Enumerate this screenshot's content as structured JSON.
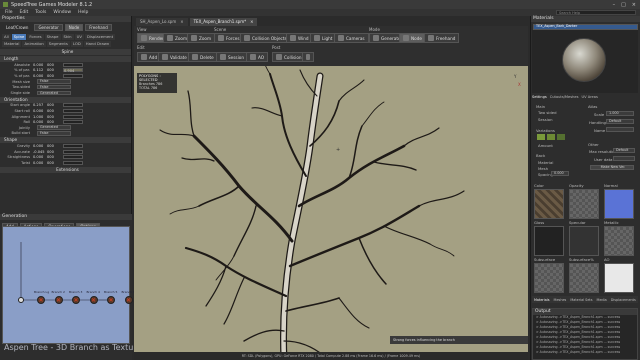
{
  "window": {
    "title": "SpeedTree Games Modeler 8.1.2",
    "controls": [
      "–",
      "□",
      "×"
    ]
  },
  "menu": {
    "items": [
      "File",
      "Edit",
      "Tools",
      "Window",
      "Help"
    ],
    "search_placeholder": "Search Help"
  },
  "left": {
    "properties_header": "Properties",
    "mode_label": "Leaf/Crown",
    "mode_buttons": [
      "Generator",
      "Node",
      "Freehand"
    ],
    "tabs": [
      "All",
      "Spine",
      "Forces",
      "Shape",
      "Skin",
      "UV",
      "Displacement",
      "Material",
      "Animation",
      "Segments",
      "LOD",
      "Hand Drawn"
    ],
    "section_spine": "Spine",
    "section_length": "Length",
    "length_rows": [
      {
        "label": "Absolute",
        "value": "0.000",
        "extra": "000"
      },
      {
        "label": "% of par.",
        "value": "0.112",
        "extra": "000",
        "drop": "0.904"
      },
      {
        "label": "% of par.",
        "value": "0.000",
        "extra": "000"
      },
      {
        "label": "Mesh size",
        "value": "",
        "extra": "",
        "drop": "False"
      },
      {
        "label": "Two-sided",
        "value": "",
        "extra": "",
        "drop": "False"
      },
      {
        "label": "Single side",
        "value": "",
        "extra": "",
        "drop": "Generated"
      }
    ],
    "section_orientation": "Orientation",
    "orientation_rows": [
      {
        "label": "Start angle",
        "value": "0.257",
        "extra": "000"
      },
      {
        "label": "Start roll",
        "value": "0.000",
        "extra": "000"
      },
      {
        "label": "Alignment",
        "value": "1.000",
        "extra": "000"
      },
      {
        "label": "Roll",
        "value": "0.000",
        "extra": "000"
      },
      {
        "label": "Jointly",
        "value": "",
        "extra": "",
        "drop": "Generated"
      },
      {
        "label": "Build start",
        "value": "",
        "extra": "",
        "drop": "False"
      }
    ],
    "section_shape": "Shape",
    "shape_rows": [
      {
        "label": "Gravity",
        "value": "0.000",
        "extra": "000"
      },
      {
        "label": "Accurate",
        "value": "-0.045",
        "extra": "000"
      },
      {
        "label": "Straightness",
        "value": "0.000",
        "extra": "000"
      },
      {
        "label": "Twist",
        "value": "0.000",
        "extra": "000"
      }
    ],
    "extensions_label": "Extensions",
    "generation_header": "Generation",
    "gen_buttons": [
      "Add",
      "Actions",
      "Operations",
      "Options"
    ],
    "nodes": [
      "Branch Lg",
      "Branch 2",
      "Branch 3",
      "Branch 4",
      "Branch 5",
      "Branch 6"
    ],
    "watermark": "Aspen Tree - 3D Branch as Texture"
  },
  "center": {
    "doc_tabs": [
      {
        "label": "SH_Aspen_Lo.spm",
        "active": false
      },
      {
        "label": "TEX_Aspen_Branch1.spm*",
        "active": true
      }
    ],
    "groups": {
      "view": "View",
      "scene": "Scene",
      "mode": "Mode",
      "edit": "Edit",
      "post": "Post"
    },
    "view_buttons": [
      "Render",
      "Zoom",
      "Zoom"
    ],
    "scene_buttons": [
      "Forces",
      "Collision Objects",
      "Wind",
      "Light",
      "Cameras"
    ],
    "mode_buttons": [
      "Generator",
      "Node",
      "Freehand"
    ],
    "edit_buttons": [
      "Add",
      "Validate",
      "Delete",
      "Session",
      "AO",
      "Collision",
      ""
    ],
    "info": {
      "header": "POLYGONS : SELECTED",
      "rows": [
        {
          "label": "Branches",
          "value": "786"
        },
        {
          "label": "TOTAL",
          "value": "786"
        }
      ]
    },
    "status_msg": "Strong forces influencing the branch",
    "status_bar": "RT: SDL (Polygons), GPU: GeForce RTX 2080 / Total Compute 2.88 ms (Frame 16.6 ms) / (Frame 1009.49 ms)"
  },
  "right": {
    "materials_header": "Materials",
    "material_name": "TEX_Aspen_Bark_Darker",
    "tabs": [
      "Settings",
      "Cutouts/Meshes",
      "UV Areas"
    ],
    "fields": {
      "main": "Main",
      "two_sided": "Two sided",
      "session": "Session",
      "variations": "Variations",
      "amount": "Amount",
      "back": "Back",
      "material": "Material",
      "more": "Mesh",
      "spacing": "Spacing",
      "spacing_val": "0.000",
      "atlas": "Atlas",
      "scale": "Scale",
      "scale_val": "1.000",
      "handling": "Handling",
      "handling_val": "Default",
      "name": "Name",
      "other": "Other",
      "max_resolution": "Max resolution",
      "max_res_val": "Default",
      "user_data": "User data",
      "make_new": "Make New Ver."
    },
    "maps": [
      "Color",
      "Opacity",
      "Normal",
      "Gloss",
      "Specular",
      "Metallic",
      "Subsurface",
      "Subsurface%",
      "AO"
    ],
    "bottom_tabs": [
      "Materials",
      "Meshes",
      "Material Sets",
      "Media",
      "Displacements"
    ],
    "output_header": "Output",
    "output_lines": [
      "> Autosaving ->TEX_Aspen_Branch1.spm ... success",
      "> Autosaving ->TEX_Aspen_Branch1.spm ... success",
      "> Autosaving ->TEX_Aspen_Branch1.spm ... success",
      "> Autosaving ->TEX_Aspen_Branch1.spm ... success",
      "> Autosaving ->TEX_Aspen_Branch1.spm ... success",
      "> Autosaving ->TEX_Aspen_Branch1.spm ... success",
      "> Autosaving ->TEX_Aspen_Branch1.spm ... success",
      "> Autosaving ->TEX_Aspen_Branch1.spm ... success"
    ]
  },
  "colors": {
    "viewport_bg": "#a4a083",
    "graph_bg": "#8a9ec7",
    "accent": "#4a7ab8",
    "normal_map": "#5a73d6"
  }
}
